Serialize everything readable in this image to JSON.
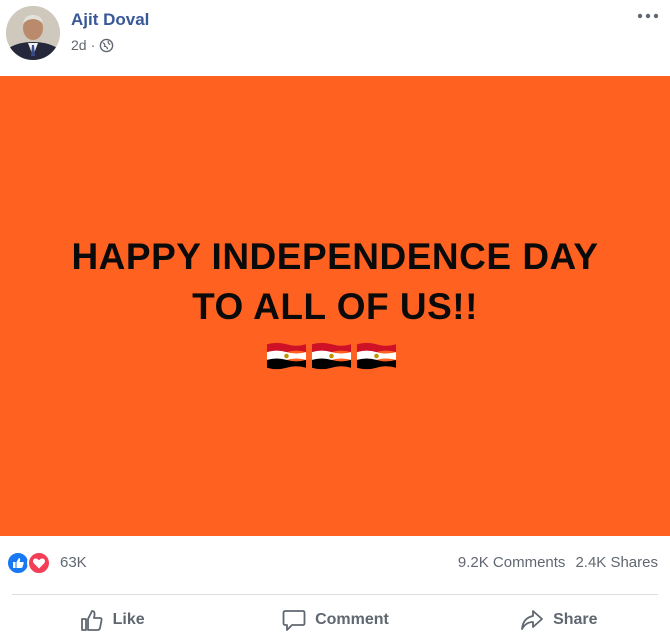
{
  "post": {
    "author": "Ajit Doval",
    "time": "2d",
    "separator": "·",
    "privacy_icon": "globe-icon",
    "more_icon": "more-options-icon"
  },
  "banner": {
    "background": "#ff6120",
    "line1": "HAPPY INDEPENDENCE DAY",
    "line2": "TO ALL OF US!!",
    "flags": [
      "egypt-flag-icon",
      "egypt-flag-icon",
      "egypt-flag-icon"
    ]
  },
  "reactions": {
    "icons": [
      "like-reaction-icon",
      "love-reaction-icon"
    ],
    "count": "63K",
    "comments": "9.2K Comments",
    "shares": "2.4K Shares"
  },
  "actions": {
    "like": "Like",
    "comment": "Comment",
    "share": "Share"
  },
  "colors": {
    "author_link": "#385898",
    "like_blue": "#1877f2",
    "love_red": "#f33e58",
    "muted_text": "#606770"
  }
}
